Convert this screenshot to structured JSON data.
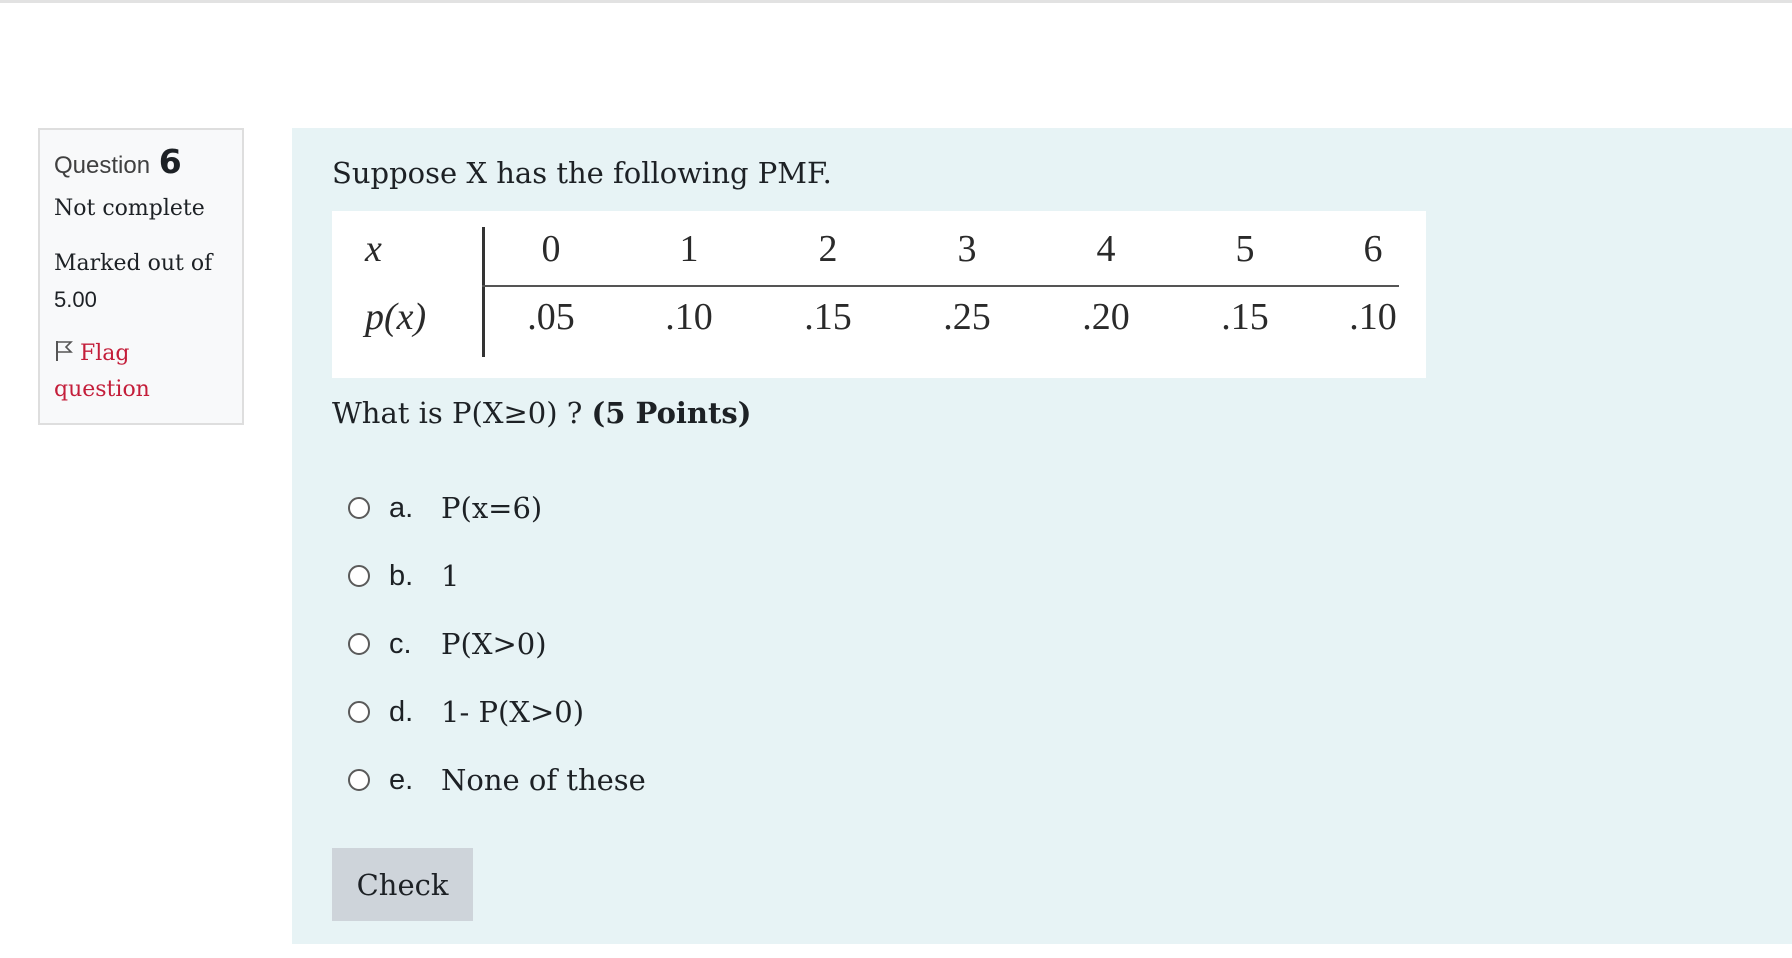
{
  "question_info": {
    "label": "Question",
    "number": "6",
    "state": "Not complete",
    "marked_label": "Marked out of",
    "marked_value": "5.00",
    "flag_label": "Flag question"
  },
  "question": {
    "intro": "Suppose X has the following PMF.",
    "prompt": "What is P(X≥0) ?",
    "points": "(5 Points)",
    "pmf_table": {
      "row_labels": [
        "x",
        "p(x)"
      ],
      "x_values": [
        "0",
        "1",
        "2",
        "3",
        "4",
        "5",
        "6"
      ],
      "p_values": [
        ".05",
        ".10",
        ".15",
        ".25",
        ".20",
        ".15",
        ".10"
      ]
    },
    "answers": [
      {
        "letter": "a.",
        "text": "P(x=6)",
        "selected": false
      },
      {
        "letter": "b.",
        "text": "1",
        "selected": false
      },
      {
        "letter": "c.",
        "text": "P(X>0)",
        "selected": false
      },
      {
        "letter": "d.",
        "text": "1- P(X>0)",
        "selected": false
      },
      {
        "letter": "e.",
        "text": "None of these",
        "selected": false
      }
    ],
    "check_label": "Check"
  },
  "colors": {
    "content_bg": "#e7f3f5",
    "info_bg": "#f8f9fa",
    "flag_color": "#c41e3a",
    "button_bg": "#ced4da"
  },
  "icons": {
    "flag": "flag-icon"
  }
}
